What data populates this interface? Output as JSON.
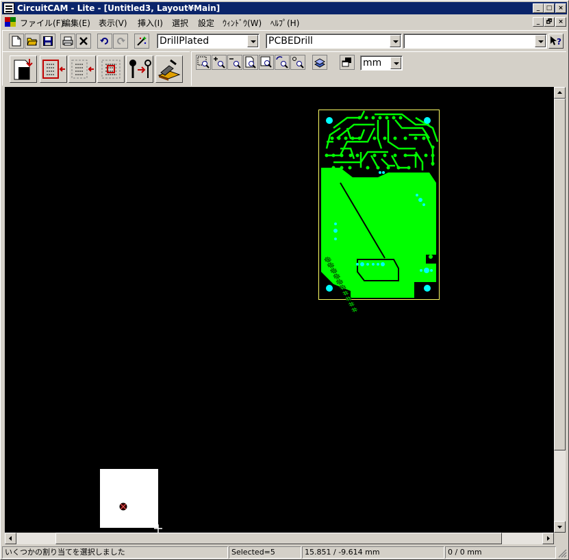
{
  "window": {
    "title": "CircuitCAM - Lite - [Untitled3, Layout¥Main]",
    "caption_buttons": [
      "_",
      "□",
      "×"
    ]
  },
  "menu": {
    "items": [
      "ファイル(F)",
      "編集(E)",
      "表示(V)",
      "挿入(I)",
      "選択",
      "設定",
      "ｳｨﾝﾄﾞｳ(W)",
      "ﾍﾙﾌﾟ(H)"
    ],
    "mdi_buttons": [
      "_",
      "🗗",
      "×"
    ]
  },
  "toolbar": {
    "layer_combo": "DrillPlated",
    "tool_combo": "PCBEDrill",
    "third_combo": "",
    "unit_combo": "mm",
    "help_icon": "?"
  },
  "colors": {
    "canvas": "#000000",
    "pcb_copper": "#00ff00",
    "pad": "#00ffff",
    "board_outline": "#ffff66",
    "title_bar": "#0a246a"
  },
  "status": {
    "message": "いくつかの割り当てを選択しました",
    "selected": "Selected=5",
    "coords": "15.851 / -9.614 mm",
    "distance": "0 / 0 mm"
  }
}
